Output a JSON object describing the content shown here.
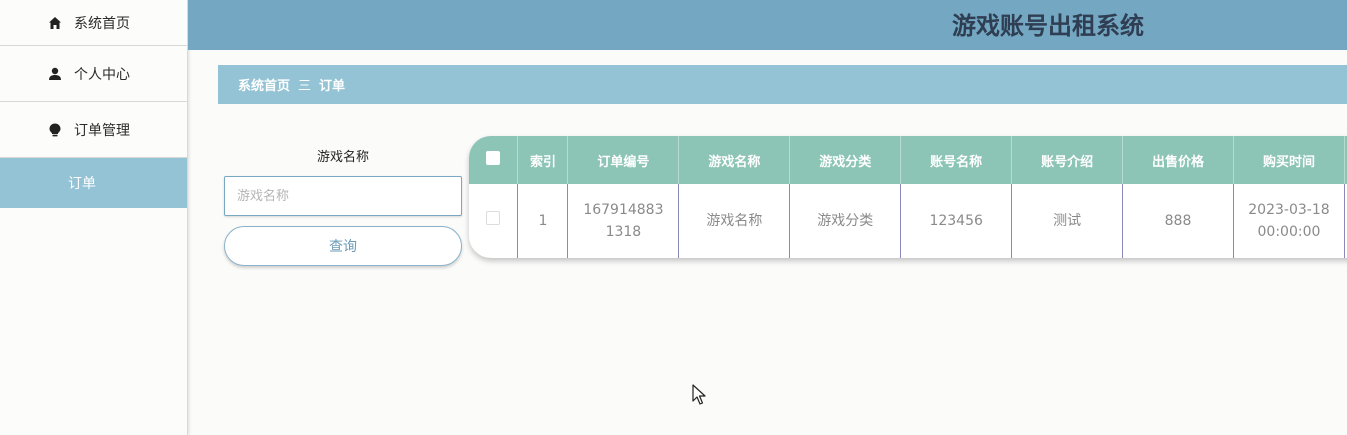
{
  "app": {
    "title": "游戏账号出租系统"
  },
  "sidebar": {
    "items": [
      {
        "label": "系统首页",
        "icon": "home-icon"
      },
      {
        "label": "个人中心",
        "icon": "user-icon"
      },
      {
        "label": "订单管理",
        "icon": "bulb-icon"
      }
    ],
    "sub_items": [
      {
        "label": "订单"
      }
    ]
  },
  "breadcrumb": {
    "home": "系统首页",
    "separator": "三",
    "current": "订单"
  },
  "search": {
    "label": "游戏名称",
    "placeholder": "游戏名称",
    "value": "",
    "button": "查询"
  },
  "table": {
    "columns": [
      "索引",
      "订单编号",
      "游戏名称",
      "游戏分类",
      "账号名称",
      "账号介绍",
      "出售价格",
      "购买时间"
    ],
    "rows": [
      [
        "1",
        "1679148831318",
        "游戏名称",
        "游戏分类",
        "123456",
        "测试",
        "888",
        "2023-03-18 00:00:00"
      ]
    ]
  },
  "colors": {
    "header": "#74a7c2",
    "breadcrumb": "#93c3d4",
    "table_head": "#8cc4b6",
    "title": "#2f3e52"
  }
}
